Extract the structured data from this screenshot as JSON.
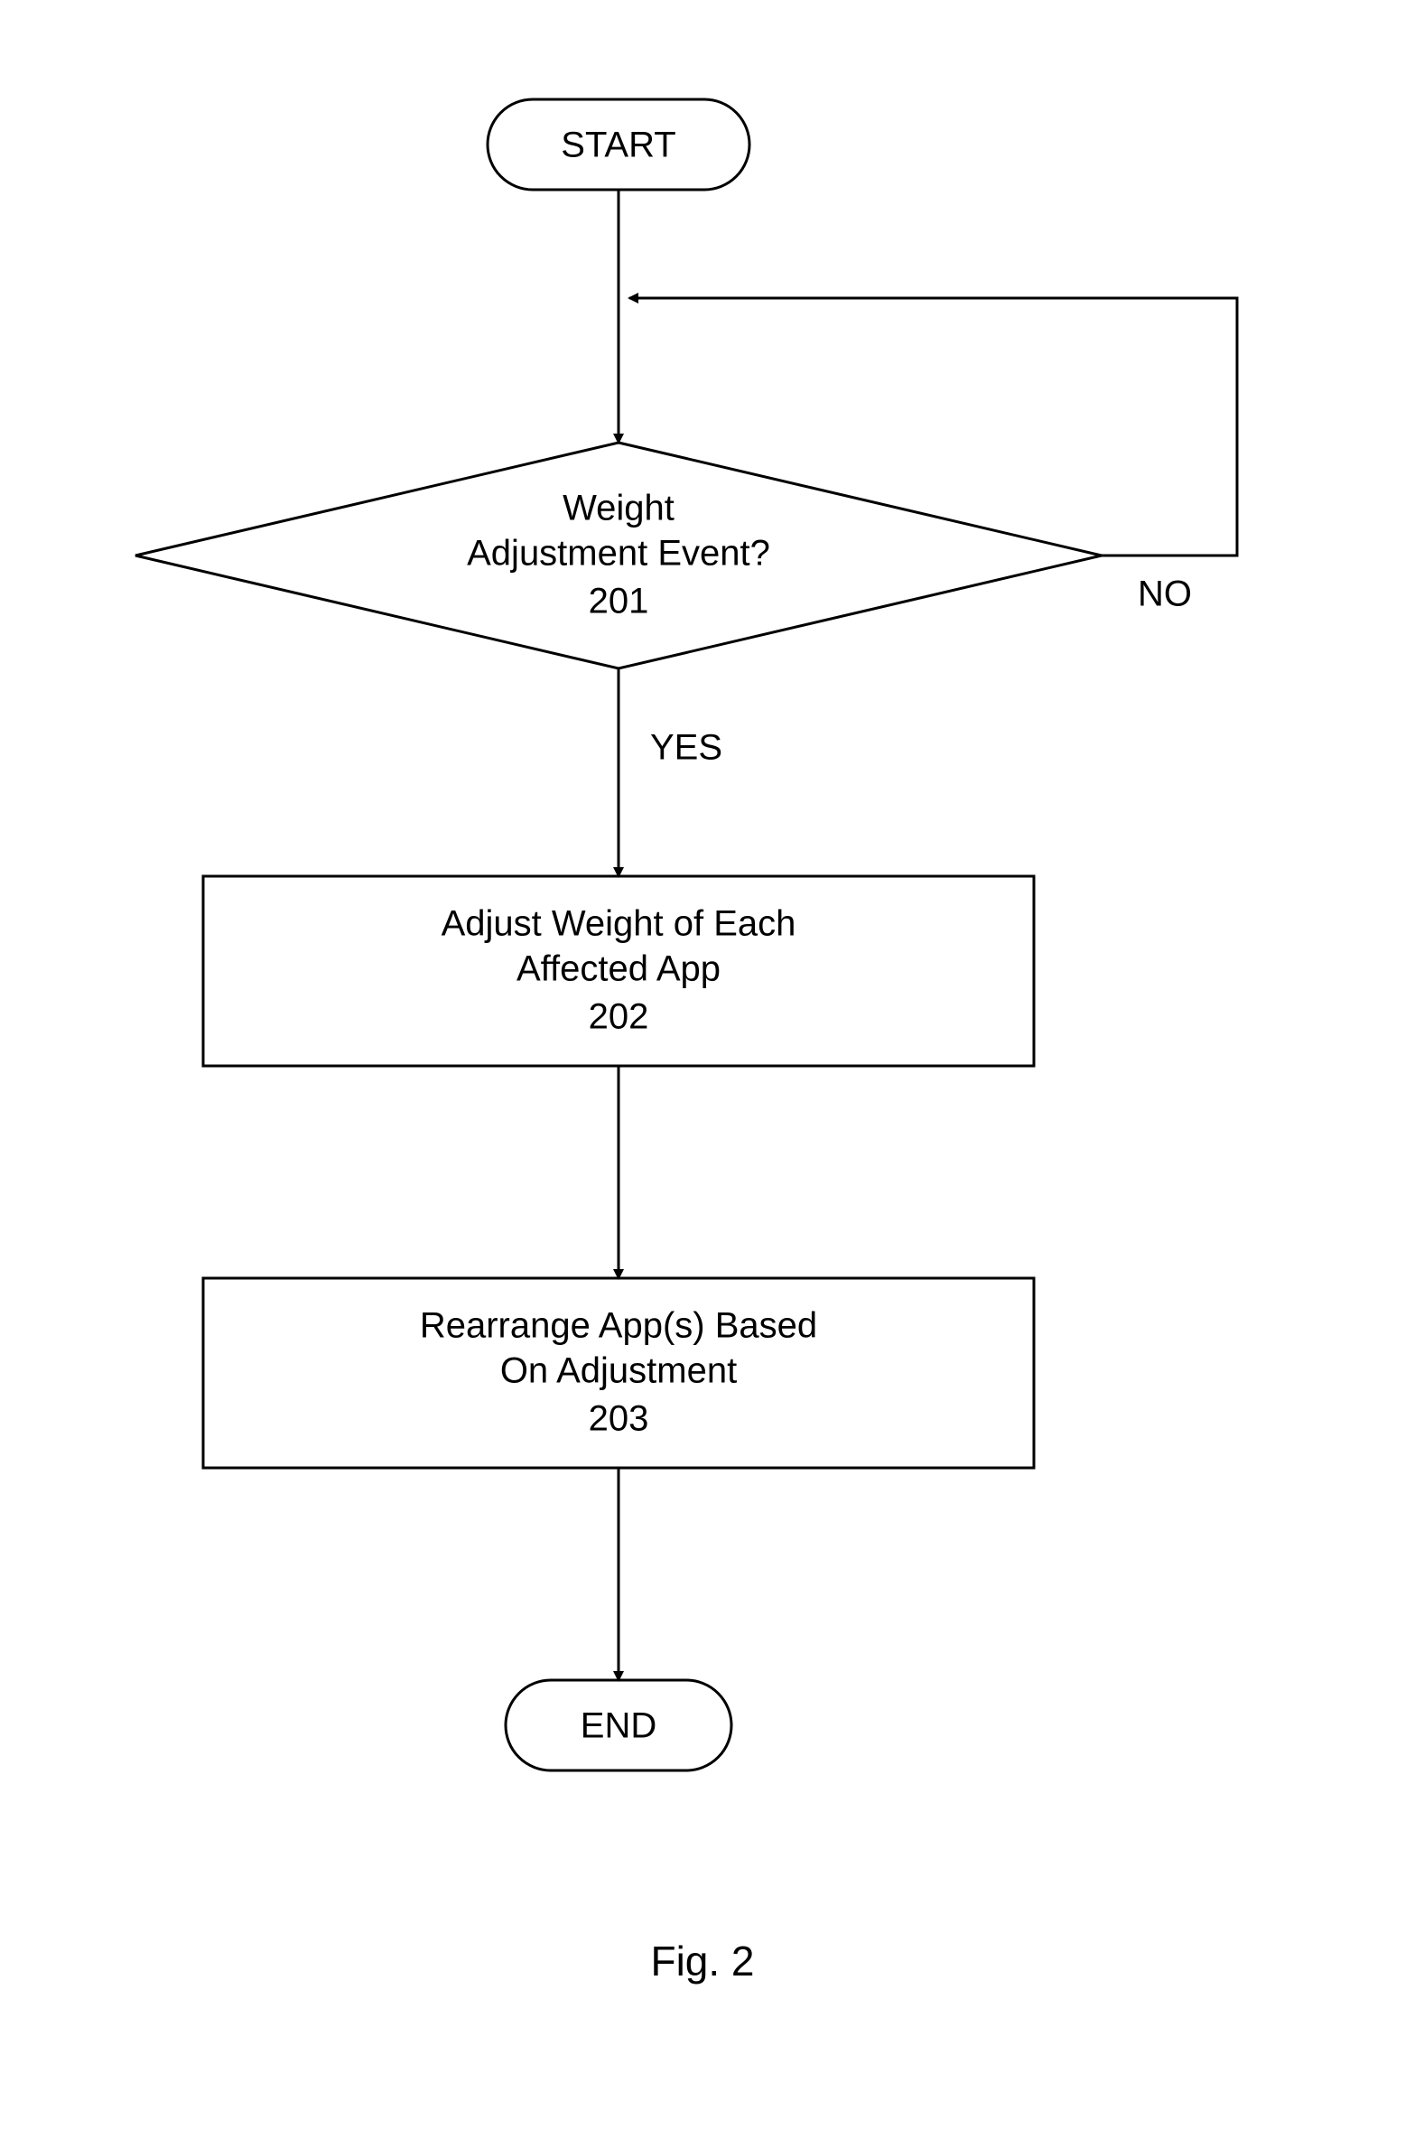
{
  "flowchart": {
    "start": {
      "label": "START"
    },
    "decision": {
      "line1": "Weight",
      "line2": "Adjustment Event?",
      "ref": "201",
      "yes_label": "YES",
      "no_label": "NO"
    },
    "process1": {
      "line1": "Adjust Weight of Each",
      "line2": "Affected App",
      "ref": "202"
    },
    "process2": {
      "line1": "Rearrange App(s) Based",
      "line2": "On Adjustment",
      "ref": "203"
    },
    "end": {
      "label": "END"
    },
    "caption": "Fig. 2"
  }
}
